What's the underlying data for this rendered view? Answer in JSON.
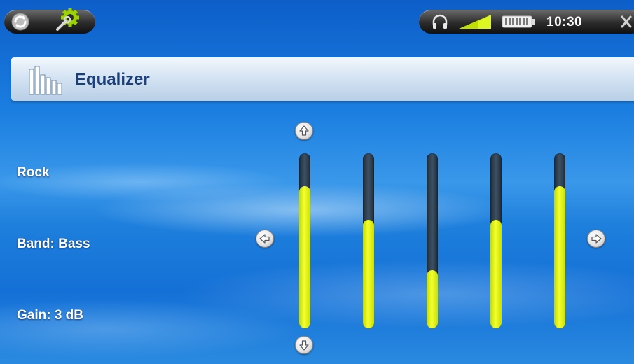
{
  "status_bar": {
    "time": "10:30",
    "icons": [
      "sync-icon",
      "settings-icon",
      "headphones-icon",
      "signal-icon",
      "battery-icon",
      "close-icon"
    ]
  },
  "header": {
    "title": "Equalizer",
    "icon": "equalizer-icon"
  },
  "equalizer": {
    "preset": "Rock",
    "band": "Band: Bass",
    "gain": "Gain: 3 dB",
    "bands": [
      {
        "level": 0.81
      },
      {
        "level": 0.62
      },
      {
        "level": 0.33
      },
      {
        "level": 0.62
      },
      {
        "level": 0.81
      }
    ]
  },
  "colors": {
    "slider_fill": "#e8f510",
    "slider_track": "#2e3e4e",
    "title_text": "#1c3f78",
    "label_text": "#ffffff"
  }
}
